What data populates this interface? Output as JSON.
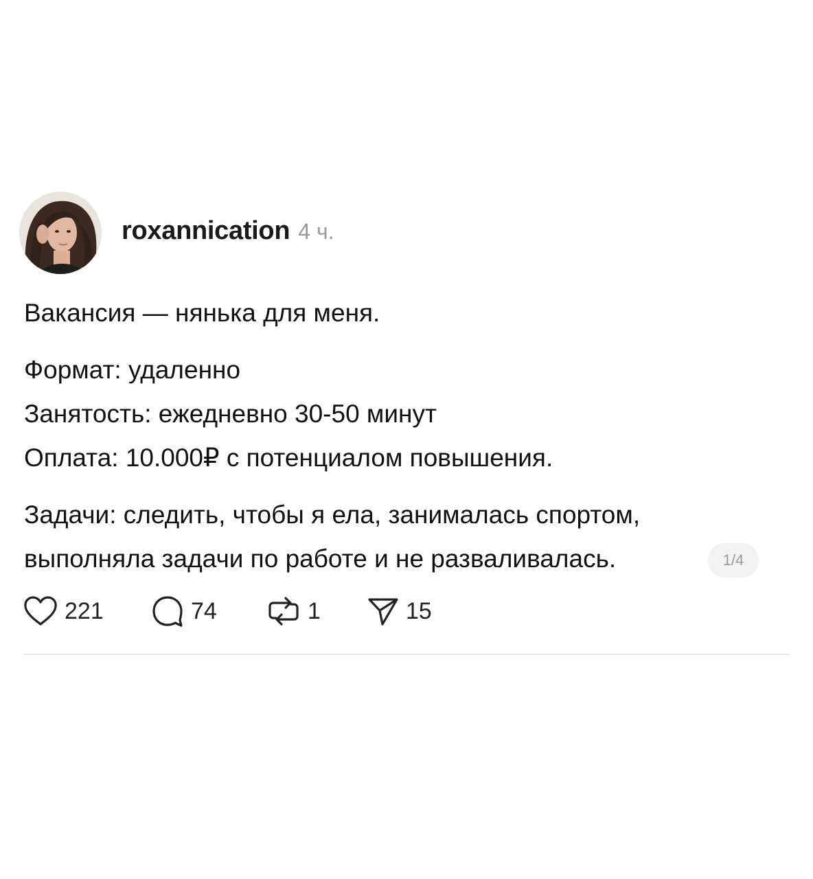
{
  "post": {
    "username": "roxannication",
    "timestamp": "4 ч.",
    "lines": [
      "Вакансия — нянька для меня.",
      "Формат: удаленно",
      "Занятость: ежедневно 30-50 минут",
      "Оплата: 10.000₽ с потенциалом повышения.",
      "Задачи: следить, чтобы я ела, занималась спортом,",
      "выполняла задачи по работе и не разваливалась."
    ],
    "page_indicator": "1/4"
  },
  "actions": {
    "likes": "221",
    "comments": "74",
    "reposts": "1",
    "shares": "15"
  },
  "icons": {
    "like": "heart-icon",
    "comment": "comment-bubble-icon",
    "repost": "repost-icon",
    "share": "send-icon"
  },
  "colors": {
    "text": "#111111",
    "muted": "#9a9a9a",
    "badge_bg": "#f2f2f2",
    "divider": "#dcdcdc"
  }
}
